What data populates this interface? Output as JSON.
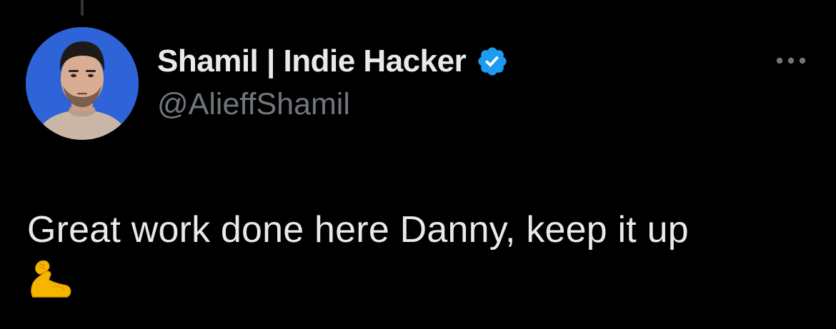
{
  "tweet": {
    "author": {
      "display_name": "Shamil | Indie Hacker",
      "handle": "@AlieffShamil",
      "verified": true,
      "verified_icon": "verified-badge-icon",
      "avatar_icon": "avatar-photo"
    },
    "more_icon": "more-options-icon",
    "text": "Great work done here Danny, keep it up",
    "emoji": "flexed-biceps-emoji"
  },
  "colors": {
    "background": "#000000",
    "primary_text": "#e7e9ea",
    "secondary_text": "#71767b",
    "verified_blue": "#1d9bf0",
    "avatar_bg": "#2f63d8",
    "thread_line": "#333639"
  }
}
